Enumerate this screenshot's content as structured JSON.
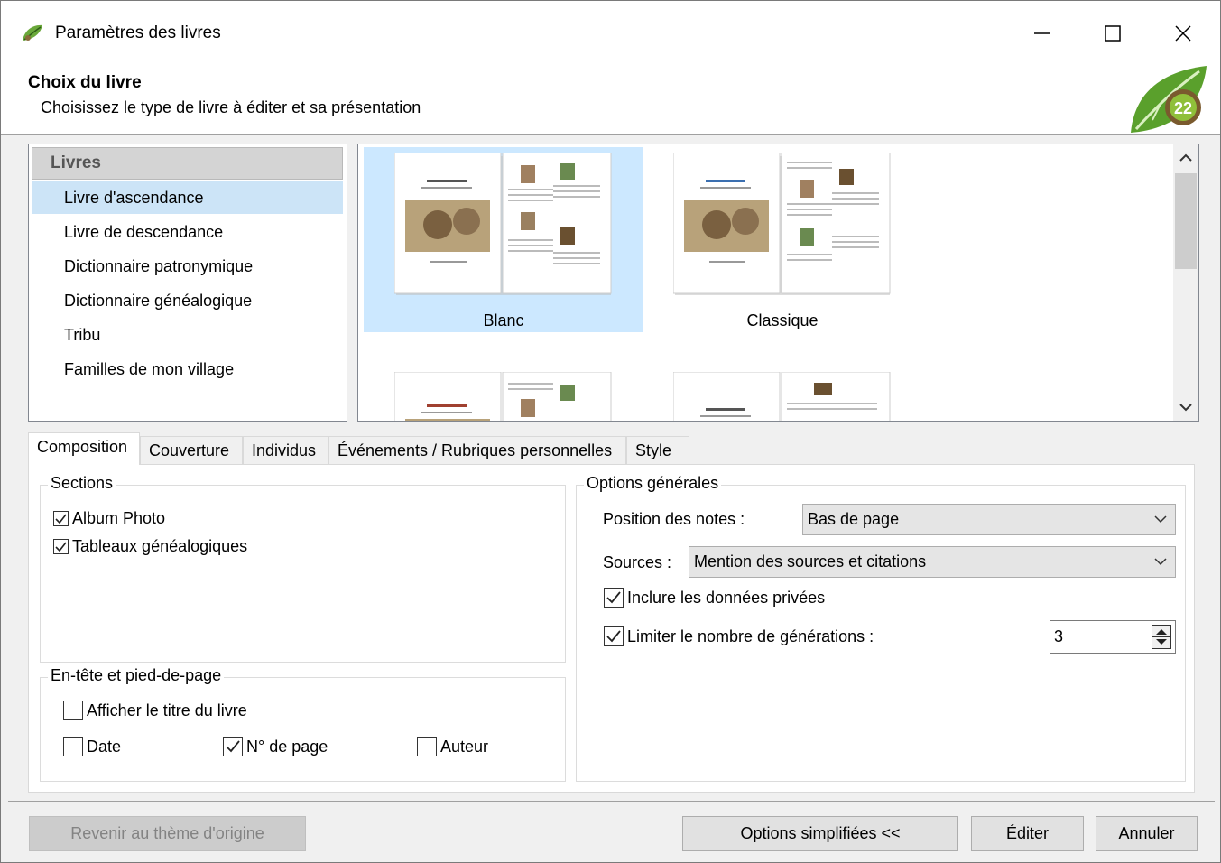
{
  "window": {
    "title": "Paramètres des livres",
    "controls": [
      "minimize",
      "maximize",
      "close"
    ]
  },
  "header": {
    "title": "Choix du livre",
    "subtitle": "Choisissez le type de livre à éditer et sa présentation",
    "logo_text": "22"
  },
  "books": {
    "header": "Livres",
    "items": [
      {
        "label": "Livre d'ascendance",
        "selected": true
      },
      {
        "label": "Livre de descendance",
        "selected": false
      },
      {
        "label": "Dictionnaire patronymique",
        "selected": false
      },
      {
        "label": "Dictionnaire généalogique",
        "selected": false
      },
      {
        "label": "Tribu",
        "selected": false
      },
      {
        "label": "Familles de mon village",
        "selected": false
      }
    ]
  },
  "themes": {
    "items": [
      {
        "label": "Blanc",
        "selected": true
      },
      {
        "label": "Classique",
        "selected": false
      },
      {
        "label": "",
        "selected": false
      },
      {
        "label": "",
        "selected": false
      }
    ]
  },
  "tabs": [
    {
      "label": "Composition",
      "active": true
    },
    {
      "label": "Couverture",
      "active": false
    },
    {
      "label": "Individus",
      "active": false
    },
    {
      "label": "Événements / Rubriques personnelles",
      "active": false
    },
    {
      "label": "Style",
      "active": false
    }
  ],
  "sections": {
    "legend": "Sections",
    "album_photo": {
      "label": "Album Photo",
      "checked": true
    },
    "tableaux": {
      "label": "Tableaux généalogiques",
      "checked": true
    }
  },
  "header_footer": {
    "legend": "En-tête et pied-de-page",
    "show_title": {
      "label": "Afficher le titre du livre",
      "checked": false
    },
    "date": {
      "label": "Date",
      "checked": false
    },
    "page_number": {
      "label": "N° de page",
      "checked": true
    },
    "author": {
      "label": "Auteur",
      "checked": false
    }
  },
  "general_options": {
    "legend": "Options générales",
    "notes_position_label": "Position des notes :",
    "notes_position_value": "Bas de page",
    "sources_label": "Sources :",
    "sources_value": "Mention des sources et citations",
    "include_private": {
      "label": "Inclure les données privées",
      "checked": true
    },
    "limit_generations": {
      "label": "Limiter le nombre de générations :",
      "checked": true
    },
    "generations_value": "3"
  },
  "buttons": {
    "reset_theme": "Revenir au thème d'origine",
    "simple_options": "Options simplifiées <<",
    "edit": "Éditer",
    "cancel": "Annuler"
  }
}
